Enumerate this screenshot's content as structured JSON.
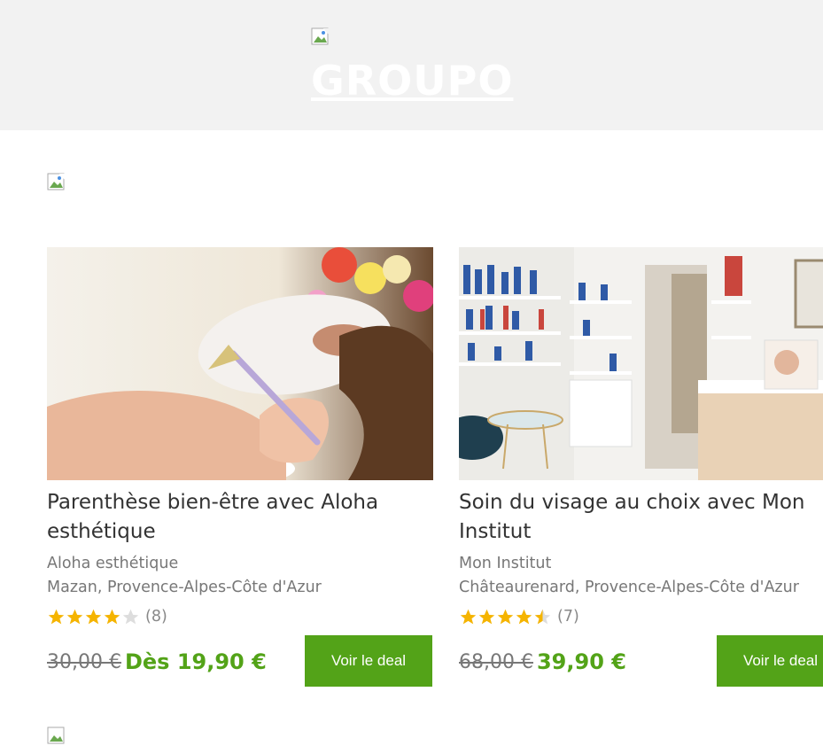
{
  "header": {
    "logo_text": "GROUPO",
    "background": "#f2f2f2"
  },
  "deals": [
    {
      "title": "Parenthèse bien-être avec Aloha esthétique",
      "merchant": "Aloha esthétique",
      "location": "Mazan, Provence-Alpes-Côte d'Azur",
      "rating": 4,
      "rating_count": "(8)",
      "old_price": "30,00 €",
      "new_price": "Dès 19,90 €",
      "button_label": "Voir le deal"
    },
    {
      "title": "Soin du visage au choix avec Mon Institut",
      "merchant": "Mon Institut",
      "location": "Châteaurenard, Provence-Alpes-Côte d'Azur",
      "rating": 4.5,
      "rating_count": "(7)",
      "old_price": "68,00 €",
      "new_price": "39,90 €",
      "button_label": "Voir le deal"
    }
  ],
  "colors": {
    "accent_green": "#53a318",
    "star_gold": "#f5b400",
    "star_empty": "#dddddd"
  },
  "icons": [
    "broken-image-icon",
    "star-icon"
  ]
}
